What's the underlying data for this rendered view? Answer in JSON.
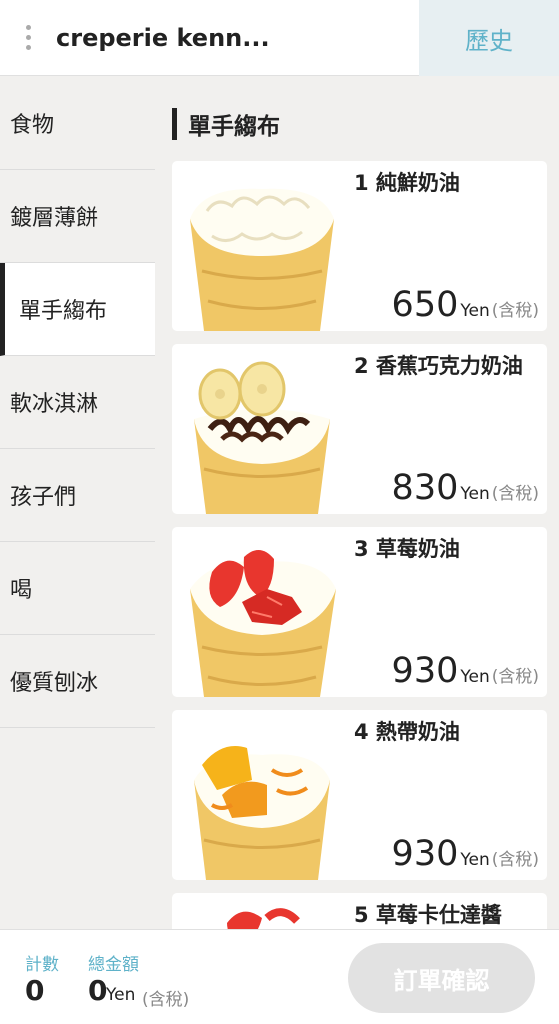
{
  "header": {
    "title": "creperie kenn...",
    "history_label": "歷史"
  },
  "sidebar": {
    "items": [
      {
        "label": "食物"
      },
      {
        "label": "鍍層薄餅"
      },
      {
        "label": "單手縐布"
      },
      {
        "label": "軟冰淇淋"
      },
      {
        "label": "孩子們"
      },
      {
        "label": "喝"
      },
      {
        "label": "優質刨冰"
      }
    ],
    "active_index": 2
  },
  "section": {
    "title": "單手縐布"
  },
  "items": [
    {
      "name": "1 純鮮奶油",
      "price": "650",
      "unit": "Yen",
      "tax": "(含稅)"
    },
    {
      "name": "2 香蕉巧克力奶油",
      "price": "830",
      "unit": "Yen",
      "tax": "(含稅)"
    },
    {
      "name": "3 草莓奶油",
      "price": "930",
      "unit": "Yen",
      "tax": "(含稅)"
    },
    {
      "name": "4 熱帶奶油",
      "price": "930",
      "unit": "Yen",
      "tax": "(含稅)"
    },
    {
      "name": "5 草莓卡仕達醬",
      "price": "",
      "unit": "",
      "tax": ""
    }
  ],
  "footer": {
    "count_label": "計數",
    "count_value": "0",
    "total_label": "總金額",
    "total_value": "0",
    "total_unit": "Yen",
    "total_tax": "(含稅)",
    "order_label": "訂單確認"
  },
  "colors": {
    "accent": "#5fb2c9",
    "disabled_button": "#e2e2e2",
    "crepe": "#f0c766",
    "strawberry": "#e8362e"
  }
}
